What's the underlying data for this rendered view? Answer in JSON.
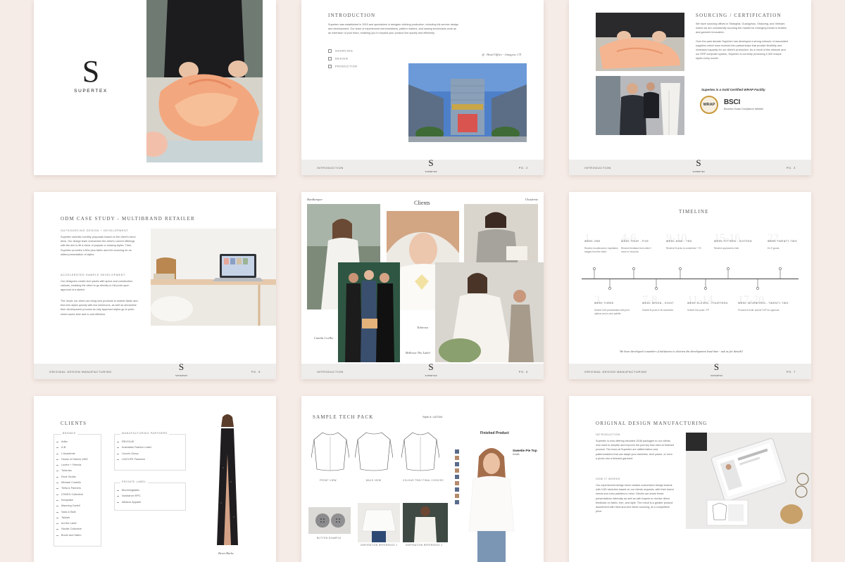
{
  "brand": {
    "logo_letter": "S",
    "name": "SUPERTEX"
  },
  "p2": {
    "title": "INTRODUCTION",
    "body": "Supertex was established in 2003 and specializes in designer clothing production, including full-service design and development. Our team of experienced merchandisers, pattern makers, and sewing technicians work as an extension of your team, enabling you to expand your product line quickly and efficiently.",
    "checklist": [
      "SOURCING",
      "DESIGN",
      "PRODUCTION"
    ],
    "office_caption": "Head Office - Jiangyin, CN",
    "footer_left": "INTRODUCTION",
    "footer_right": "PG. 2"
  },
  "p3": {
    "title": "SOURCING / CERTIFICATION",
    "body1": "We have sourcing offices in Shanghai, Guangzhou, Shaoxing, and Vietnam, where we are consistently scouring the market for emerging trends in textiles and garment innovation.",
    "body2": "Over the past decade Supertex has developed a strong network of associated suppliers which have evolved into partnerships that provide flexibility and increased capacity for our client's production. As a result of this network and our ERP computer system, Supertex is currently producing 2,000 unique styles every month.",
    "cert": "Supertex is a Gold Certified WRAP Facility",
    "wrap": "WRAP",
    "bsci": "BSCI",
    "bsci_sub": "Business Social Compliance Initiative",
    "footer_left": "INTRODUCTION",
    "footer_right": "PG. 3"
  },
  "p4": {
    "title": "ODM CASE STUDY - MULTIBRAND RETAILER",
    "sub1": "OUTSOURCING DESIGN + DEVELOPMENT",
    "body1": "Supertex submits monthly proposals based on the client's trend deck. Our design team researches the client's current offerings with the aim to fill a niche of popular or missing styles. Then, Supertex provides CADs plus fabric and trim sourcing for an edited presentation of styles.",
    "sub2": "ACCELERATED SAMPLE DEVELOPMENT",
    "body2": "Our designers create tech packs with specs and construction callouts, enabling the client to go directly to full proto upon approval of a sketch.",
    "body3": "The result: our client can bring new products to market faster and test new styles quickly with low minimums, as well as streamline their development process as only approved styles go to proto which saves time and is cost effective.",
    "footer_left": "ORIGINAL DESIGN MANUFACTURING",
    "footer_right": "PG. 5"
  },
  "p5": {
    "title": "Clients",
    "labels": [
      "Bardkemper",
      "Ulcadenie",
      "Camila Coelho",
      "Tularosa",
      "Bellevue The Label"
    ],
    "footer_left": "INTRODUCTION",
    "footer_right": "PG. 6"
  },
  "p6": {
    "title": "TIMELINE",
    "top": [
      {
        "num": "1",
        "week": "WEEK ONE",
        "desc": "Receive moodboard or inspiration images from the client"
      },
      {
        "num": "4-6",
        "week": "WEEK FOUR - FIVE",
        "desc": "Receive feedback from client + move to 1st proto"
      },
      {
        "num": "9-10",
        "week": "WEEK NINE - TEN",
        "desc": "Receive fit proto to comments + FC"
      },
      {
        "num": "15-16",
        "week": "WEEK FIFTEEN - SIXTEEN",
        "desc": "Receive approval to bulk"
      },
      {
        "num": "22",
        "week": "WEEK TWENTY TWO",
        "desc": "Ex-F goods"
      }
    ],
    "bottom": [
      {
        "num": "3",
        "week": "WEEK THREE",
        "desc": "Submit CAD presentation with print options and a color palette"
      },
      {
        "num": "7-8",
        "week": "WEEK SEVEN - EIGHT",
        "desc": "Submit fit proto to fit comments"
      },
      {
        "num": "11-14",
        "week": "WEEK ELEVEN - FOURTEEN",
        "desc": "Submit 2nd proto / FP"
      },
      {
        "num": "17-20",
        "week": "WEEK SEVENTEEN - TWENTY TWO",
        "desc": "Proceed to bulk; submit TOP for approval"
      }
    ],
    "note": "We have developed a number of initiatives to shorten the development lead time - ask us for details!",
    "footer_left": "ORIGINAL DESIGN MANUFACTURING",
    "footer_right": "PG. 7"
  },
  "p7": {
    "title": "CLIENTS",
    "brands_head": "BRANDS",
    "brands": [
      "Adler",
      "A.B.",
      "L'Academie",
      "House of Harlow 1960",
      "Lovers + Friends",
      "Tularosa",
      "Rove Studio",
      "Michael Costello",
      "Tiella & Partners",
      "LPA/EG Collective",
      "Keepsake",
      "Manning Cartell",
      "Sass & Bide",
      "Talulah",
      "Art the Label",
      "Nicolle Collective",
      "Bromi and Sabro"
    ],
    "partners_head": "MANUFACTURING PARTNERS",
    "partners": [
      "REVOLVE",
      "Australian Fashion Label",
      "Lincoln Group",
      "LINCLIFE Fashions"
    ],
    "private_head": "PRIVATE LABEL",
    "private": [
      "Bloomingdales",
      "Nordstrom RPC",
      "Alliance Apparel"
    ],
    "caption": "Bevet Burke"
  },
  "p8": {
    "title": "SAMPLE TECH PACK",
    "style": "Style #: LAT204",
    "views": [
      "FRONT VIEW",
      "BACK VIEW",
      "COLOUR TRAY FINAL CHOICES"
    ],
    "bottom": [
      "BUTTON EXAMPLE",
      "INSPIRATION REFERENCE 1",
      "INSPIRATION REFERENCE 2"
    ],
    "finished": "Finished Product",
    "product": "Sweetie Pie Top",
    "product_sub": "Details"
  },
  "p9": {
    "title": "ORIGINAL DESIGN MANUFACTURING",
    "sub1": "INTRODUCTION",
    "body1": "Supertex is now offering elevated ODM packages to our clients who want to simplify and improve the journey from idea to finished product. The team at Supertex are skilled tailors and patternmakers that can adapt your sketches, tech packs, or even a photo into a finished garment.",
    "sub2": "HOW IT WORKS",
    "body2": "Our experienced design team creates customized design boards with CAD sketches based on our clients requests, with their brand needs and color palettes in mind. Clients can share these presentations internally as well as with buyers to receive direct feedback on fabric, trim, and style. The result is a greater product assortment with tried-and-true fabric sourcing, at a competitive price."
  }
}
